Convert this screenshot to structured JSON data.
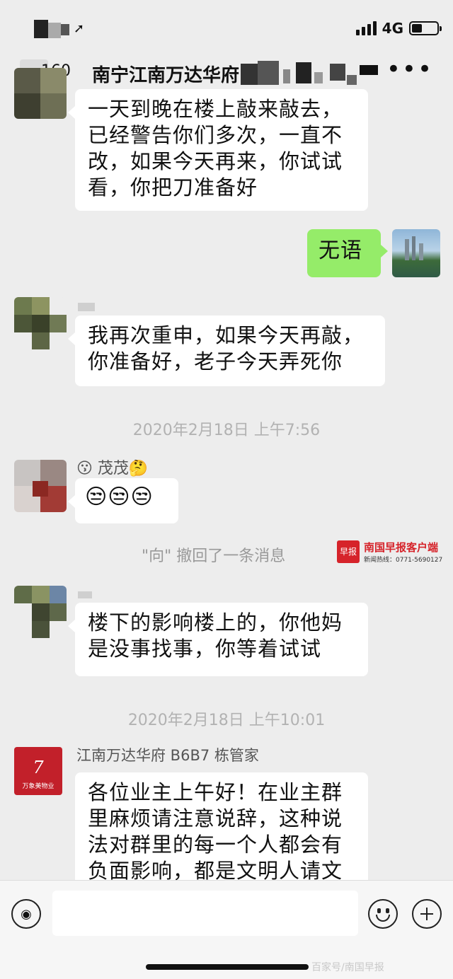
{
  "status": {
    "network": "4G",
    "signal_bars": 4,
    "battery_level": 0.4
  },
  "header": {
    "badge": "160",
    "title": "南宁江南万达华府",
    "more": "•••"
  },
  "messages": [
    {
      "side": "left",
      "text": "一天到晚在楼上敲来敲去，已经警告你们多次，一直不改，如果今天再来，你试试看，你把刀准备好"
    },
    {
      "side": "right",
      "text": "无语"
    },
    {
      "side": "left",
      "text": "我再次重申，如果今天再敲，你准备好，老子今天弄死你"
    },
    {
      "timestamp": "2020年2月18日 上午7:56"
    },
    {
      "side": "left",
      "nickname": "😗 茂茂🤔",
      "text": "😒😒😒"
    },
    {
      "system": "\"向\" 撤回了一条消息"
    },
    {
      "side": "left",
      "text": "楼下的影响楼上的，你他妈是没事找事，你等着试试"
    },
    {
      "timestamp": "2020年2月18日 上午10:01"
    },
    {
      "side": "left",
      "nickname": "江南万达华府 B6B7 栋管家",
      "avatar_caption": "万象美物业",
      "text": "各位业主上午好！在业主群里麻烦请注意说辞，这种说法对群里的每一个人都会有负面影响，都是文明人请文"
    }
  ],
  "watermark": {
    "logo": "早报",
    "name": "南国早报客户端",
    "hotline": "新闻热线：0771-5690127"
  },
  "composer": {
    "input_value": "",
    "corner_watermark": "百家号/南国早报"
  },
  "colors": {
    "background": "#ededed",
    "bubble_self": "#95ec69",
    "bubble_other": "#ffffff",
    "watermark_red": "#d6232a"
  }
}
